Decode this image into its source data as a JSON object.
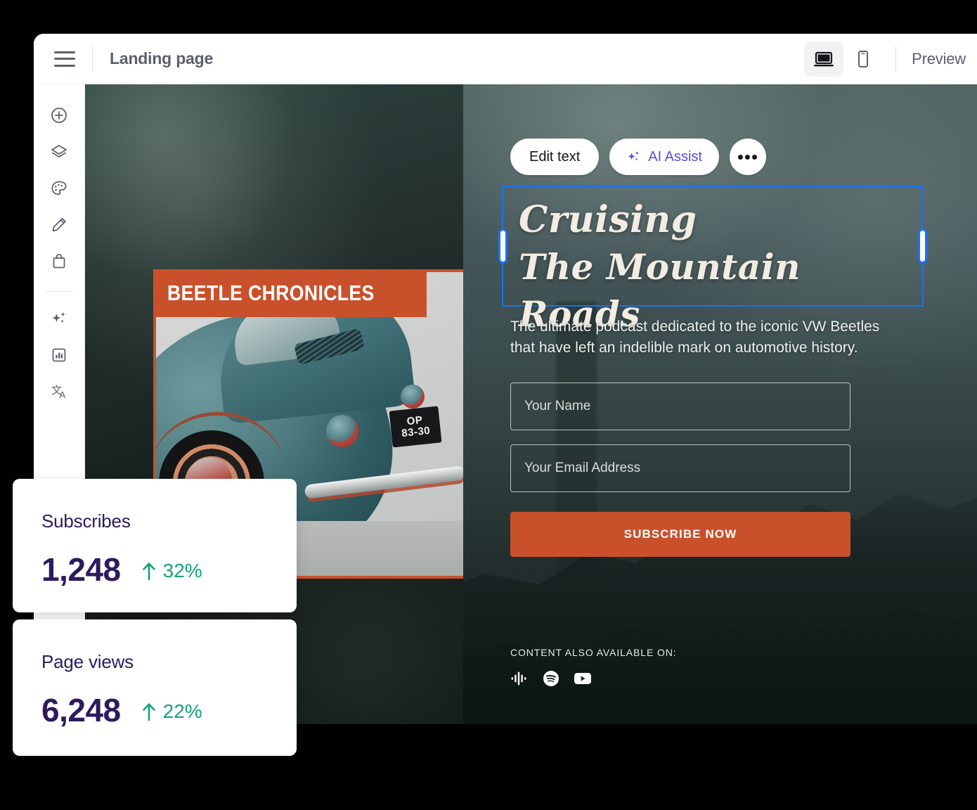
{
  "window": {
    "topbar": {
      "menu_icon": "hamburger-menu-icon",
      "title": "Landing page",
      "device_desktop_icon": "desktop-icon",
      "device_mobile_icon": "mobile-icon",
      "preview_label": "Preview"
    },
    "sidebar": {
      "items": [
        {
          "name": "add",
          "icon": "plus-circle-icon"
        },
        {
          "name": "layers",
          "icon": "layers-icon"
        },
        {
          "name": "theme",
          "icon": "palette-icon"
        },
        {
          "name": "edit",
          "icon": "pencil-icon"
        },
        {
          "name": "store",
          "icon": "shopping-bag-icon"
        },
        {
          "name": "ai",
          "icon": "sparkles-icon"
        },
        {
          "name": "analytics",
          "icon": "bar-chart-icon"
        },
        {
          "name": "translate",
          "icon": "translate-icon"
        }
      ]
    }
  },
  "beetle_card": {
    "banner_title": "BEETLE CHRONICLES",
    "license_plate_line1": "OP",
    "license_plate_line2": "83-30",
    "border_color": "#c8512b",
    "car_color": "#3e6c73"
  },
  "editbar": {
    "edit_text_label": "Edit text",
    "ai_assist_label": "AI Assist",
    "ai_icon": "sparkles-icon",
    "ai_color": "#5b4ae0",
    "more_label": "•••",
    "selection_color": "#1b72f2"
  },
  "hero": {
    "headline_line1": "Cruising",
    "headline_line2": "The Mountain Roads",
    "subtext": "The ultimate podcast dedicated to the iconic VW Beetles that have left an indelible mark on automotive history.",
    "form": {
      "name_placeholder": "Your Name",
      "name_value": "",
      "email_placeholder": "Your Email Address",
      "email_value": "",
      "cta_label": "SUBSCRIBE NOW",
      "cta_color": "#c8512b"
    },
    "footer": {
      "label": "CONTENT ALSO AVAILABLE ON:",
      "platforms": [
        {
          "name": "google-podcasts",
          "icon": "google-podcasts-icon"
        },
        {
          "name": "spotify",
          "icon": "spotify-icon"
        },
        {
          "name": "youtube",
          "icon": "youtube-icon"
        }
      ]
    }
  },
  "stats": [
    {
      "label": "Subscribes",
      "value": "1,248",
      "delta": "32%",
      "trend_icon": "arrow-up-icon",
      "trend_color": "#12a47a",
      "value_color": "#2d1b5e"
    },
    {
      "label": "Page views",
      "value": "6,248",
      "delta": "22%",
      "trend_icon": "arrow-up-icon",
      "trend_color": "#12a47a",
      "value_color": "#2d1b5e"
    }
  ]
}
